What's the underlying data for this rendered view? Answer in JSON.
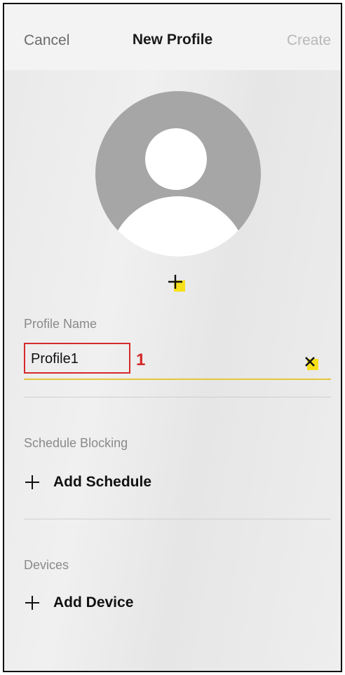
{
  "header": {
    "cancel_label": "Cancel",
    "title": "New Profile",
    "create_label": "Create"
  },
  "profile_name": {
    "label": "Profile Name",
    "value": "Profile1",
    "step_badge": "1"
  },
  "schedule": {
    "label": "Schedule Blocking",
    "add_label": "Add Schedule"
  },
  "devices": {
    "label": "Devices",
    "add_label": "Add Device"
  },
  "colors": {
    "highlight": "#f7e01a",
    "annotation_red": "#d62a2a",
    "input_underline": "#e5c63a",
    "avatar_gray": "#a6a6a6"
  },
  "icons": [
    "avatar-placeholder",
    "add-photo-plus-icon",
    "clear-x-icon",
    "plus-icon"
  ]
}
